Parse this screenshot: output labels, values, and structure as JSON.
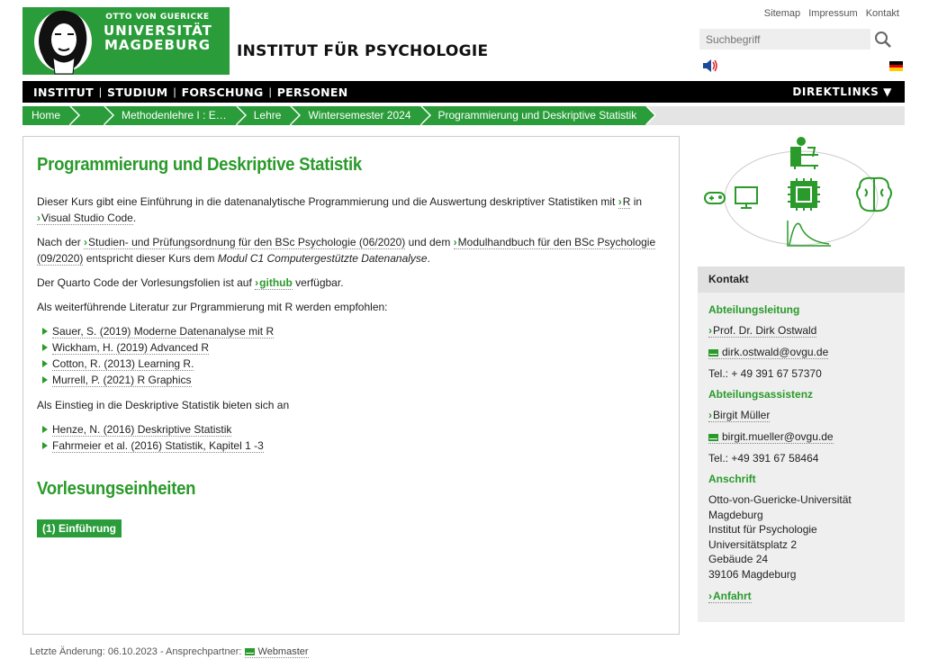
{
  "header": {
    "logo": {
      "line1": "OTTO VON GUERICKE",
      "line2": "UNIVERSITÄT",
      "line3": "MAGDEBURG"
    },
    "institute": "INSTITUT FÜR PSYCHOLOGIE",
    "toplinks": [
      "Sitemap",
      "Impressum",
      "Kontakt"
    ],
    "search_placeholder": "Suchbegriff"
  },
  "nav": {
    "items": [
      "INSTITUT",
      "STUDIUM",
      "FORSCHUNG",
      "PERSONEN"
    ],
    "direktlinks": "DIREKTLINKS"
  },
  "breadcrumb": [
    "Home",
    "",
    "Methodenlehre I : E…",
    "Lehre",
    "Wintersemester 2024",
    "Programmierung und Deskriptive Statistik"
  ],
  "main": {
    "title": "Programmierung und Deskriptive Statistik",
    "p1_a": "Dieser Kurs gibt eine Einführung in die datenanalytische Programmierung und die Auswertung deskriptiver Statistiken mit",
    "p1_link1": "R",
    "p1_b": "in",
    "p1_link2": "Visual Studio Code",
    "p1_c": ".",
    "p2_a": "Nach der",
    "p2_link1": "Studien- und Prüfungsordnung für den BSc Psychologie (06/2020)",
    "p2_b": "und dem",
    "p2_link2": "Modulhandbuch für den BSc Psychologie (09/2020)",
    "p2_c": "entspricht dieser Kurs dem",
    "p2_em": "Modul C1 Computergestützte Datenanalyse",
    "p2_d": ".",
    "p3_a": "Der Quarto Code der Vorlesungsfolien ist auf",
    "p3_link": "github",
    "p3_b": "verfügbar.",
    "p4": "Als weiterführende Literatur zur Prgrammierung mit R werden empfohlen:",
    "literature": [
      "Sauer, S. (2019) Moderne Datenanalyse mit R",
      "Wickham, H. (2019) Advanced R",
      "Cotton, R. (2013) Learning R.",
      "Murrell, P. (2021) R Graphics"
    ],
    "p5": "Als Einstieg in die Deskriptive Statistik bieten sich an",
    "stats_lit": [
      "Henze, N. (2016) Deskriptive Statistik",
      "Fahrmeier et al. (2016) Statistik, Kapitel 1 -3"
    ],
    "section_title": "Vorlesungseinheiten",
    "lecture_button": "(1) Einführung"
  },
  "contact": {
    "heading": "Kontakt",
    "lead_label": "Abteilungsleitung",
    "lead_name": "Prof. Dr. Dirk Ostwald",
    "lead_email": "dirk.ostwald@ovgu.de",
    "lead_tel": "Tel.: + 49 391 67 57370",
    "assist_label": "Abteilungsassistenz",
    "assist_name": "Birgit Müller",
    "assist_email": "birgit.mueller@ovgu.de",
    "assist_tel": "Tel.: +49 391 67 58464",
    "address_label": "Anschrift",
    "address": [
      "Otto-von-Guericke-Universität",
      "Magdeburg",
      "Institut für Psychologie",
      "Universitätsplatz 2",
      "Gebäude 24",
      "39106 Magdeburg"
    ],
    "anfahrt": "Anfahrt"
  },
  "footer": {
    "text": "Letzte Änderung: 06.10.2023 - Ansprechpartner:",
    "link": "Webmaster"
  },
  "colors": {
    "accent": "#2a9d3a",
    "nav_bg": "#000000",
    "panel_bg": "#efefef"
  }
}
